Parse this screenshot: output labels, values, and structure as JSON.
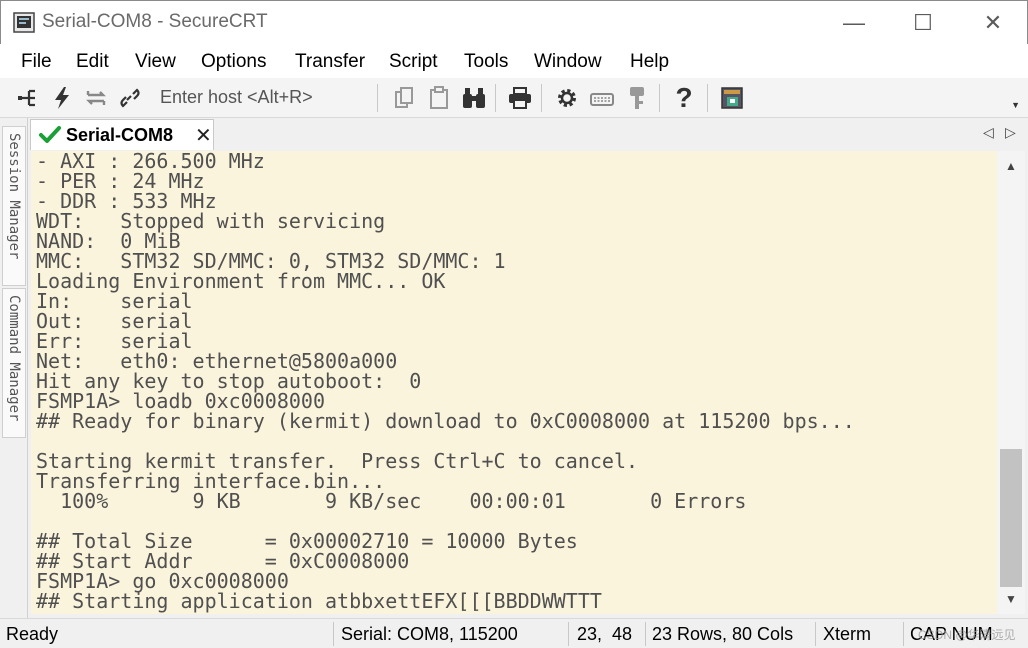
{
  "window": {
    "title": "Serial-COM8 - SecureCRT",
    "controls": {
      "minimize": "—",
      "maximize": "☐",
      "close": "✕"
    }
  },
  "menu": [
    "File",
    "Edit",
    "View",
    "Options",
    "Transfer",
    "Script",
    "Tools",
    "Window",
    "Help"
  ],
  "toolbar": {
    "host_placeholder": "Enter host <Alt+R>",
    "icons": [
      "connect-bar-icon",
      "quick-connect-icon",
      "reconnect-icon",
      "disconnect-icon",
      "copy-icon",
      "paste-icon",
      "find-icon",
      "print-icon",
      "settings-icon",
      "keymap-icon",
      "key-agent-icon",
      "help-icon",
      "sftp-icon"
    ],
    "help_glyph": "?"
  },
  "tab": {
    "label": "Serial-COM8",
    "close": "✕",
    "check": "✔"
  },
  "side_panels": [
    "Session Manager",
    "Command Manager"
  ],
  "terminal": {
    "lines": [
      "- AXI : 266.500 MHz",
      "- PER : 24 MHz",
      "- DDR : 533 MHz",
      "WDT:   Stopped with servicing",
      "NAND:  0 MiB",
      "MMC:   STM32 SD/MMC: 0, STM32 SD/MMC: 1",
      "Loading Environment from MMC... OK",
      "In:    serial",
      "Out:   serial",
      "Err:   serial",
      "Net:   eth0: ethernet@5800a000",
      "Hit any key to stop autoboot:  0",
      "FSMP1A> loadb 0xc0008000",
      "## Ready for binary (kermit) download to 0xC0008000 at 115200 bps...",
      "",
      "Starting kermit transfer.  Press Ctrl+C to cancel.",
      "Transferring interface.bin...",
      "  100%       9 KB       9 KB/sec    00:00:01       0 Errors",
      "",
      "## Total Size      = 0x00002710 = 10000 Bytes",
      "## Start Addr      = 0xC0008000",
      "FSMP1A> go 0xc0008000",
      "## Starting application atbbxettEFX[[[BBDDWWTTT"
    ],
    "colors": {
      "background": "#fbf4dc",
      "text": "#505050"
    }
  },
  "scrollbar": {
    "up": "▲",
    "down": "▼"
  },
  "tab_nav": {
    "prev": "◁",
    "next": "▷"
  },
  "status": {
    "state": "Ready",
    "connection": "Serial: COM8, 115200",
    "cursor": "23,  48",
    "size": "23 Rows, 80 Cols",
    "emulation": "Xterm",
    "keys": "CAP NUM",
    "watermark": "CSDN @华清远见"
  }
}
